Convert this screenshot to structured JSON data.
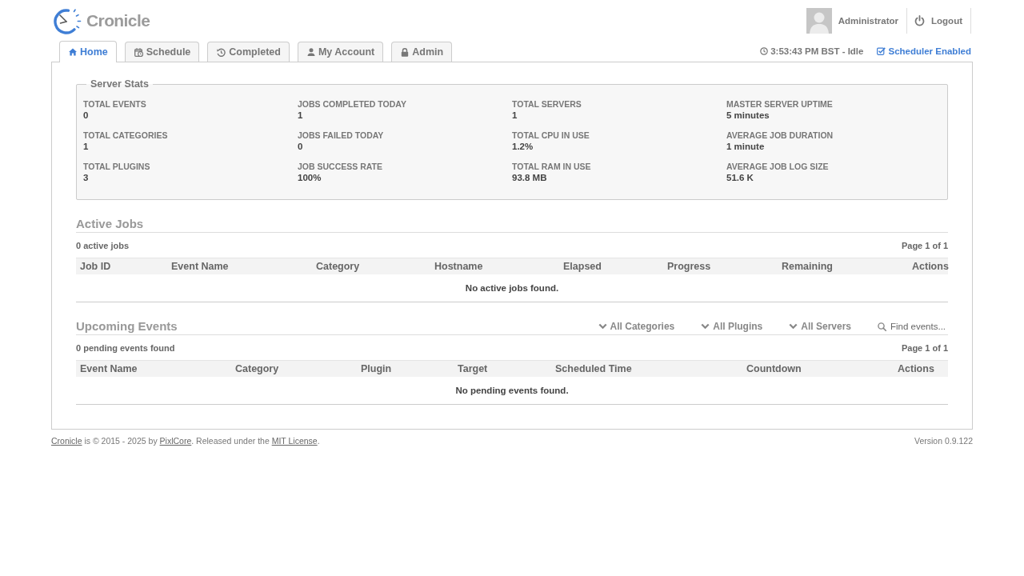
{
  "header": {
    "logo_text": "Cronicle",
    "user_name": "Administrator",
    "logout_label": "Logout"
  },
  "tabs": [
    {
      "label": "Home",
      "selected": true
    },
    {
      "label": "Schedule",
      "selected": false
    },
    {
      "label": "Completed",
      "selected": false
    },
    {
      "label": "My Account",
      "selected": false
    },
    {
      "label": "Admin",
      "selected": false
    }
  ],
  "status": {
    "clock": "3:53:43 PM BST - Idle",
    "scheduler": {
      "label": "Scheduler Enabled",
      "checked": true
    }
  },
  "server_stats": {
    "title": "Server Stats",
    "items": [
      {
        "label": "TOTAL EVENTS",
        "value": "0"
      },
      {
        "label": "JOBS COMPLETED TODAY",
        "value": "1"
      },
      {
        "label": "TOTAL SERVERS",
        "value": "1"
      },
      {
        "label": "MASTER SERVER UPTIME",
        "value": "5 minutes"
      },
      {
        "label": "TOTAL CATEGORIES",
        "value": "1"
      },
      {
        "label": "JOBS FAILED TODAY",
        "value": "0"
      },
      {
        "label": "TOTAL CPU IN USE",
        "value": "1.2%"
      },
      {
        "label": "AVERAGE JOB DURATION",
        "value": "1 minute"
      },
      {
        "label": "TOTAL PLUGINS",
        "value": "3"
      },
      {
        "label": "JOB SUCCESS RATE",
        "value": "100%"
      },
      {
        "label": "TOTAL RAM IN USE",
        "value": "93.8 MB"
      },
      {
        "label": "AVERAGE JOB LOG SIZE",
        "value": "51.6 K"
      }
    ]
  },
  "active_jobs": {
    "title": "Active Jobs",
    "count": "0 active jobs",
    "pagination": "Page 1 of 1",
    "columns": [
      "Job ID",
      "Event Name",
      "Category",
      "Hostname",
      "Elapsed",
      "Progress",
      "Remaining",
      "Actions"
    ],
    "empty_message": "No active jobs found."
  },
  "upcoming_events": {
    "title": "Upcoming Events",
    "filters": [
      "All Categories",
      "All Plugins",
      "All Servers"
    ],
    "search": {
      "placeholder": "Find events..."
    },
    "count": "0 pending events found",
    "pagination": "Page 1 of 1",
    "columns": [
      "Event Name",
      "Category",
      "Plugin",
      "Target",
      "Scheduled Time",
      "Countdown",
      "Actions"
    ],
    "empty_message": "No pending events found."
  },
  "footer": {
    "credits": [
      {
        "kind": "link",
        "text": "Cronicle"
      },
      {
        "kind": "text",
        "text": " is © 2015 - 2025 by "
      },
      {
        "kind": "link",
        "text": "PixlCore"
      },
      {
        "kind": "text",
        "text": ". Released under the "
      },
      {
        "kind": "link",
        "text": "MIT License"
      },
      {
        "kind": "text",
        "text": "."
      }
    ],
    "version": "Version 0.9.122"
  }
}
